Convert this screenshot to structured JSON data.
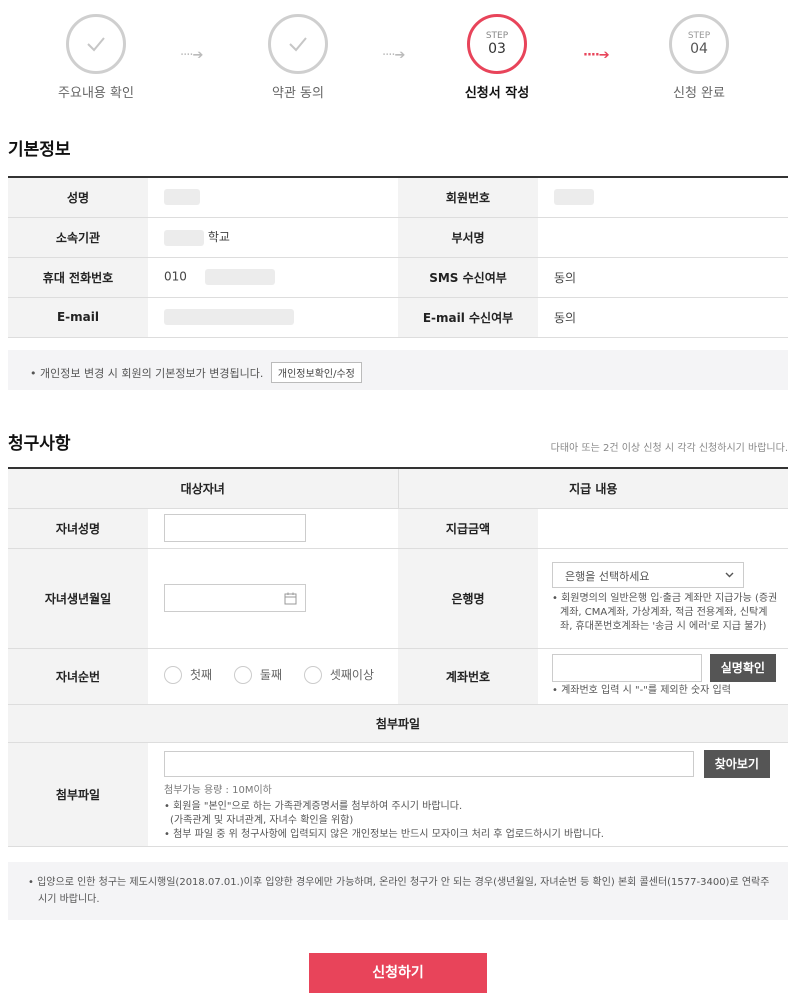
{
  "steps": [
    {
      "step_text": "",
      "num": "",
      "label": "주요내용 확인",
      "state": "done"
    },
    {
      "step_text": "",
      "num": "",
      "label": "약관 동의",
      "state": "done"
    },
    {
      "step_text": "STEP",
      "num": "03",
      "label": "신청서 작성",
      "state": "active"
    },
    {
      "step_text": "STEP",
      "num": "04",
      "label": "신청 완료",
      "state": "todo"
    }
  ],
  "arrow_glyph": "····➔",
  "basic": {
    "title": "기본정보",
    "name_label": "성명",
    "member_no_label": "회원번호",
    "org_label": "소속기관",
    "org_suffix": "학교",
    "dept_label": "부서명",
    "phone_label": "휴대 전화번호",
    "phone_prefix": "010",
    "sms_label": "SMS 수신여부",
    "sms_value": "동의",
    "email_label": "E-mail",
    "email_consent_label": "E-mail 수신여부",
    "email_consent_value": "동의"
  },
  "notice1": {
    "text": "개인정보 변경 시 회원의 기본정보가 변경됩니다.",
    "button": "개인정보확인/수정"
  },
  "claim": {
    "title": "청구사항",
    "side_note": "다태아 또는 2건 이상 신청 시 각각 신청하시기 바랍니다.",
    "col_target": "대상자녀",
    "col_pay": "지급 내용",
    "child_name_label": "자녀성명",
    "amount_label": "지급금액",
    "birth_label": "자녀생년월일",
    "bank_label": "은행명",
    "bank_placeholder": "은행을 선택하세요",
    "bank_note": "회원명의의 일반은행 입·출금 계좌만 지급가능 (증권계좌, CMA계좌, 가상계좌, 적금 전용계좌, 신탁계좌, 휴대폰번호계좌는 '송금 시 에러'로 지급 불가)",
    "order_label": "자녀순번",
    "order_options": [
      "첫째",
      "둘째",
      "셋째이상"
    ],
    "account_label": "계좌번호",
    "verify_button": "실명확인",
    "account_note": "계좌번호 입력 시 \"-\"를 제외한 숫자 입력",
    "attach_header": "첨부파일",
    "attach_label": "첨부파일",
    "browse_button": "찾아보기",
    "attach_limit": "첨부가능 용량 : 10M이하",
    "attach_note1": "회원을 \"본인\"으로 하는 가족관계증명서를 첨부하여 주시기 바랍니다.",
    "attach_note1b": "(가족관계 및 자녀관계, 자녀수 확인을 위함)",
    "attach_note2": "첨부 파일 중 위 청구사항에 입력되지 않은 개인정보는 반드시 모자이크 처리 후 업로드하시기 바랍니다."
  },
  "notice2": "입양으로 인한 청구는 제도시행일(2018.07.01.)이후 입양한 경우에만 가능하며, 온라인 청구가 안 되는 경우(생년월일, 자녀순번 등 확인) 본회 콜센터(1577-3400)로 연락주시기 바랍니다.",
  "submit_label": "신청하기"
}
